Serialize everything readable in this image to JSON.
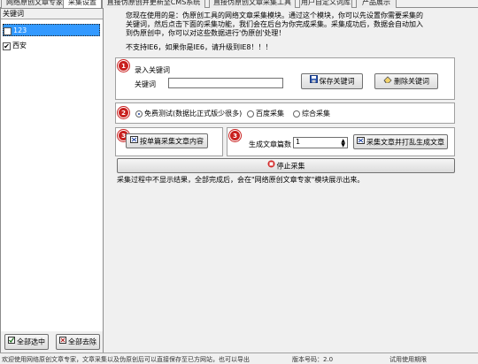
{
  "tabs": [
    {
      "label": "网络原创文章专家"
    },
    {
      "label": "采集设置"
    },
    {
      "label": "直接伪原创并更新至CMS系统"
    },
    {
      "label": "直接伪原创文章采集工具"
    },
    {
      "label": "用户自定义词库"
    },
    {
      "label": "产品展示"
    }
  ],
  "sidebar": {
    "header": "关键词",
    "keywords": [
      {
        "label": "123",
        "checked": false,
        "selected": true
      },
      {
        "label": "西安",
        "checked": true,
        "selected": false
      }
    ],
    "select_all_label": "全部选中",
    "deselect_all_label": "全部去除"
  },
  "intro": {
    "lines": [
      "您现在使用的是：伪原创工具的网络文章采集模块。通过这个模块，你可以先设置你需要采集的",
      "关键词，然后点击下面的采集功能，我们会在后台为你完成采集。采集成功后，数据会自动加入",
      "到伪原创中，你可以对这些数据进行'伪原创'处理！"
    ],
    "warning": "不支持IE6，如果你是IE6，请升级到IE8！！！"
  },
  "step1": {
    "number": "1",
    "title": "录入关键词",
    "field_label": "关键词",
    "keyword_value": "",
    "save_label": "保存关键词",
    "delete_label": "删除关键词"
  },
  "step2": {
    "number": "2",
    "options": [
      {
        "label": "免费测试(数据比正式版少很多)",
        "selected": true
      },
      {
        "label": "百度采集",
        "selected": false
      },
      {
        "label": "综合采集",
        "selected": false
      }
    ]
  },
  "step3a": {
    "number": "3",
    "button_label": "按单篇采集文章内容"
  },
  "step3b": {
    "number": "3",
    "count_label": "生成文章篇数",
    "count_value": "1",
    "button_label": "采集文章并打乱生成文章"
  },
  "stop_label": "停止采集",
  "note": "采集过程中不显示结果，全部完成后，会在\"网络原创文章专家\"模块展示出来。",
  "status": [
    {
      "text": "欢迎使用网络原创文章专家，文章采集以及伪原创后可以直接保存至已方网站，也可以导出"
    },
    {
      "text": "版本号码：2.0"
    },
    {
      "text": "试用使用期限"
    }
  ],
  "colors": {
    "badge_red": "#c9201f",
    "selection_blue": "#3399ff"
  }
}
